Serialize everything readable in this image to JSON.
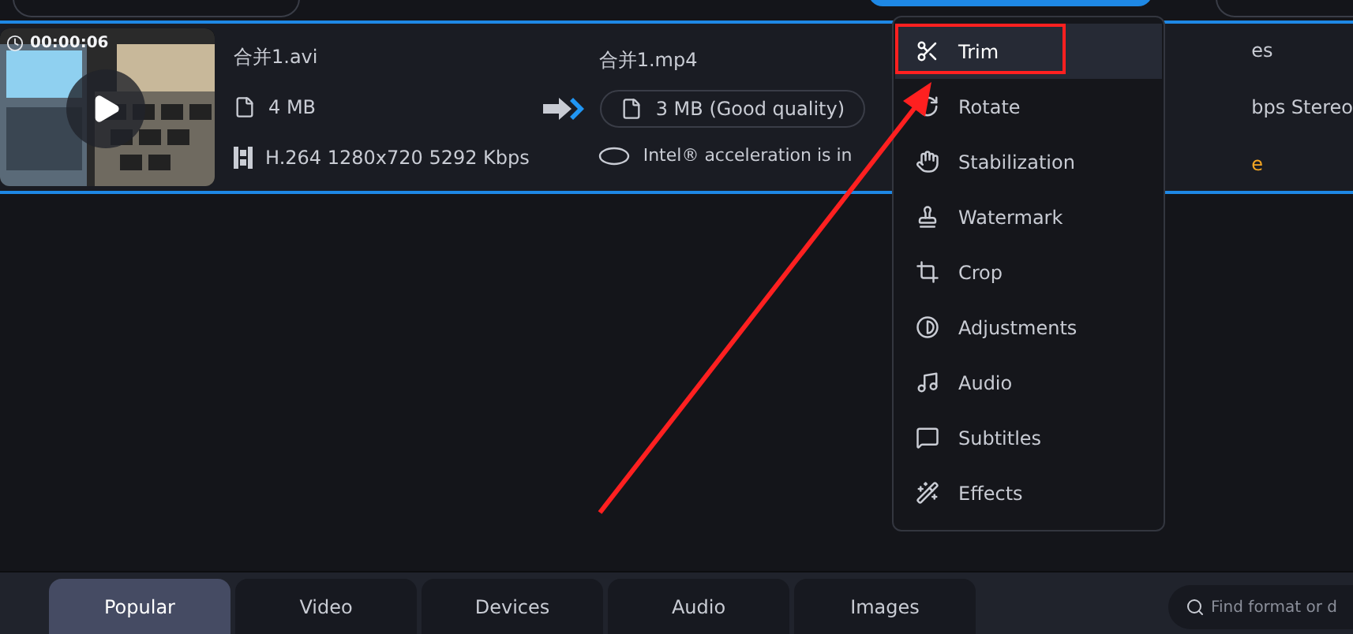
{
  "file": {
    "duration": "00:00:06",
    "source_name": "合并1.avi",
    "source_size": "4 MB",
    "source_codec": "H.264 1280x720 5292 Kbps",
    "output_name": "合并1.mp4",
    "output_size": "3 MB (Good quality)",
    "intel_note": "Intel® acceleration is in",
    "col3_line1": "es",
    "col3_line2": "bps Stereo",
    "col3_line3": "e"
  },
  "menu": {
    "items": [
      {
        "label": "Trim",
        "kind": "scissors",
        "selected": true
      },
      {
        "label": "Rotate",
        "kind": "rotate",
        "selected": false
      },
      {
        "label": "Stabilization",
        "kind": "stabilize",
        "selected": false
      },
      {
        "label": "Watermark",
        "kind": "stamp",
        "selected": false
      },
      {
        "label": "Crop",
        "kind": "crop",
        "selected": false
      },
      {
        "label": "Adjustments",
        "kind": "contrast",
        "selected": false
      },
      {
        "label": "Audio",
        "kind": "music",
        "selected": false
      },
      {
        "label": "Subtitles",
        "kind": "subtitles",
        "selected": false
      },
      {
        "label": "Effects",
        "kind": "wand",
        "selected": false
      }
    ]
  },
  "format_tabs": [
    {
      "label": "Popular",
      "selected": true
    },
    {
      "label": "Video",
      "selected": false
    },
    {
      "label": "Devices",
      "selected": false
    },
    {
      "label": "Audio",
      "selected": false
    },
    {
      "label": "Images",
      "selected": false
    }
  ],
  "search": {
    "placeholder": "Find format or d"
  }
}
